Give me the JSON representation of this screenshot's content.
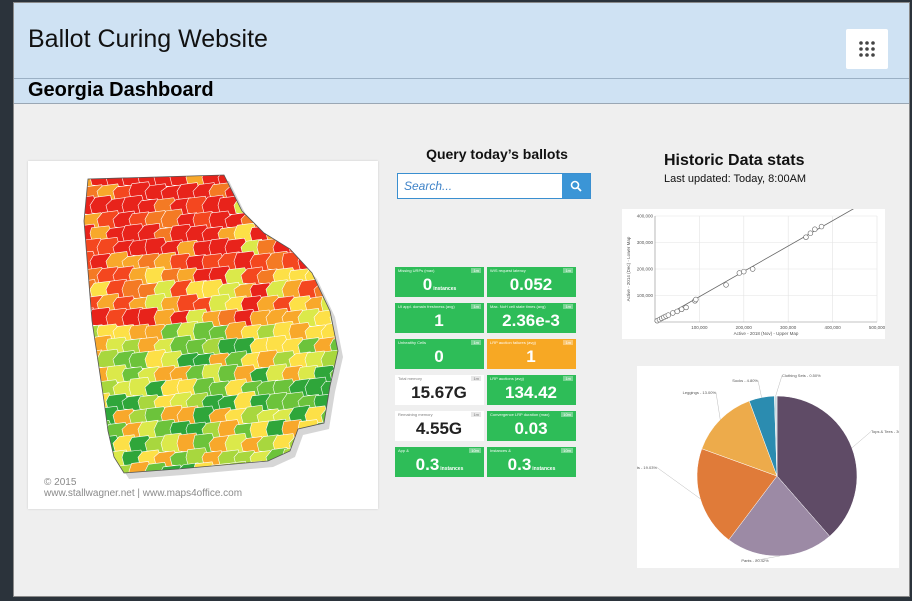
{
  "header": {
    "site_title": "Ballot Curing Website",
    "dashboard_title": "Georgia Dashboard",
    "apps_icon": "grid-icon"
  },
  "map": {
    "credit_line1": "© 2015",
    "credit_line2": "www.stallwagner.net | www.maps4office.com"
  },
  "query": {
    "title": "Query today’s ballots",
    "search_placeholder": "Search...",
    "search_icon": "search-icon"
  },
  "tiles": [
    {
      "label": "Missing URPs (max)",
      "badge": "1m",
      "value": "0",
      "unit": "instances",
      "color": "green"
    },
    {
      "label": "WIS request latency",
      "badge": "1m",
      "value": "0.052",
      "unit": "",
      "color": "green"
    },
    {
      "label": "UI appl. domain freshness (avg)",
      "badge": "1m",
      "value": "1",
      "unit": "",
      "color": "green"
    },
    {
      "label": "Max. NoH cell state times (avg)",
      "badge": "1m",
      "value": "2.36e-3",
      "unit": "",
      "color": "green"
    },
    {
      "label": "Unhealthy Cells",
      "badge": "1m",
      "value": "0",
      "unit": "",
      "color": "green"
    },
    {
      "label": "LRP auction failures (avg)",
      "badge": "1m",
      "value": "1",
      "unit": "",
      "color": "orange"
    },
    {
      "label": "Total memory",
      "badge": "1m",
      "value": "15.67G",
      "unit": "",
      "color": "white"
    },
    {
      "label": "LRP auctions (avg)",
      "badge": "1m",
      "value": "134.42",
      "unit": "",
      "color": "green"
    },
    {
      "label": "Remaining memory",
      "badge": "1m",
      "value": "4.55G",
      "unit": "",
      "color": "white"
    },
    {
      "label": "Convergence LRP duration (max)",
      "badge": "10m",
      "value": "0.03",
      "unit": "",
      "color": "green"
    },
    {
      "label": "App &",
      "badge": "10m",
      "value": "0.3",
      "unit": "instances",
      "color": "green"
    },
    {
      "label": "Instances &",
      "badge": "10m",
      "value": "0.3",
      "unit": "instances",
      "color": "green"
    }
  ],
  "historic": {
    "title": "Historic Data stats",
    "updated": "Last updated: Today, 8:00AM"
  },
  "chart_data": [
    {
      "type": "scatter",
      "title": "",
      "xlabel": "Active - 2018 (Nov) - Upper Map",
      "ylabel": "Active - 2014 (Dec) - Lower Map",
      "xlim": [
        0,
        500000
      ],
      "ylim": [
        0,
        400000
      ],
      "x_ticks": [
        "100,000",
        "200,000",
        "300,000",
        "400,000",
        "500,000"
      ],
      "y_ticks": [
        "100,000",
        "200,000",
        "300,000",
        "400,000"
      ],
      "grid": true,
      "x": [
        5000,
        10000,
        15000,
        20000,
        25000,
        30000,
        40000,
        50000,
        60000,
        70000,
        90000,
        92000,
        160000,
        190000,
        200000,
        220000,
        340000,
        350000,
        360000,
        375000
      ],
      "y": [
        5000,
        9000,
        14000,
        18000,
        22000,
        26000,
        34000,
        40000,
        48000,
        55000,
        80000,
        85000,
        140000,
        185000,
        190000,
        200000,
        320000,
        335000,
        350000,
        360000
      ],
      "trendline": true
    },
    {
      "type": "pie",
      "title": "",
      "slices": [
        {
          "label": "Tops & Tees",
          "value": 36.26,
          "color": "#5f4b66"
        },
        {
          "label": "Pants",
          "value": 20.42,
          "color": "#9c8aa5"
        },
        {
          "label": "Outerwear & Coats",
          "value": 19.03,
          "color": "#e07b39"
        },
        {
          "label": "Leggings",
          "value": 13.0,
          "color": "#edab4b"
        },
        {
          "label": "Socks",
          "value": 4.8,
          "color": "#2b8cb0"
        },
        {
          "label": "Clothing Sets",
          "value": 0.5,
          "color": "#c8d9df"
        }
      ]
    }
  ]
}
